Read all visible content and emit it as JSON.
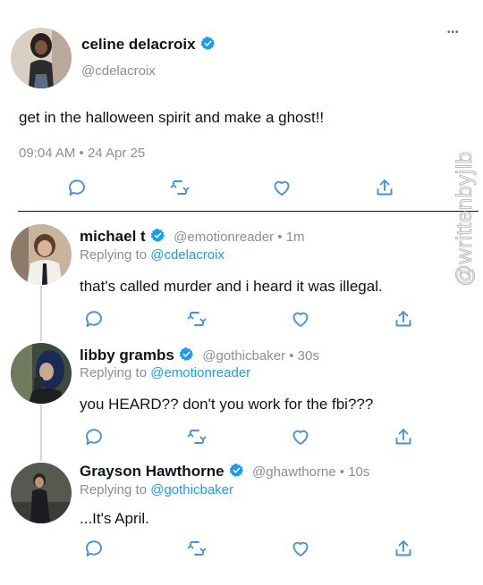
{
  "main_tweet": {
    "display_name": "celine delacroix",
    "handle": "@cdelacroix",
    "text": "get in the halloween spirit and make a ghost!!",
    "timestamp": "09:04 AM • 24 Apr 25",
    "more_glyph": "•••"
  },
  "replies": [
    {
      "display_name": "michael t",
      "handle_time": "@emotionreader • 1m",
      "replying_label": "Replying to ",
      "replying_to": "@cdelacroix",
      "text": "that's called murder and i heard it was illegal."
    },
    {
      "display_name": "libby grambs",
      "handle_time": "@gothicbaker • 30s",
      "replying_label": "Replying to ",
      "replying_to": "@emotionreader",
      "text": "you HEARD?? don't you work for the fbi???"
    },
    {
      "display_name": "Grayson Hawthorne",
      "handle_time": "@ghawthorne • 10s",
      "replying_label": "Replying to ",
      "replying_to": "@gothicbaker",
      "text": "...It's April."
    }
  ],
  "watermark": "@writtenbyjlb",
  "icons": [
    "reply-icon",
    "retweet-icon",
    "like-icon",
    "share-icon",
    "verified-icon",
    "more-icon"
  ],
  "colors": {
    "accent": "#1d9bf0",
    "icon_stroke": "#4a90d9",
    "muted": "#8a8f94"
  }
}
